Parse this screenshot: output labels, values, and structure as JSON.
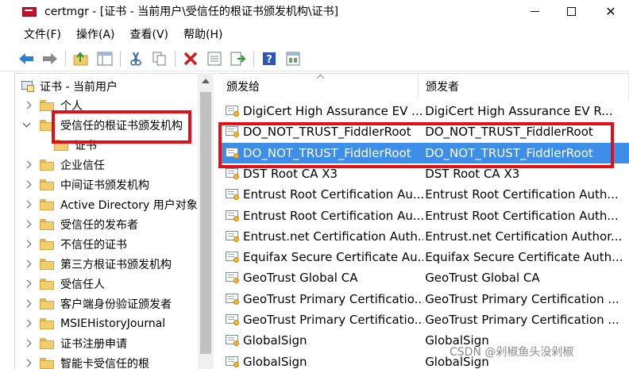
{
  "window": {
    "title": "certmgr - [证书 - 当前用户\\受信任的根证书颁发机构\\证书]",
    "controls": {
      "minimize": "",
      "maximize": "",
      "close": "✕"
    }
  },
  "menu": [
    "文件(F)",
    "操作(A)",
    "查看(V)",
    "帮助(H)"
  ],
  "toolbar": {
    "icons": [
      "back-arrow-icon",
      "forward-arrow-icon",
      "up-folder-icon",
      "show-hide-tree-icon",
      "cut-icon",
      "copy-icon",
      "delete-icon",
      "properties-icon",
      "export-icon",
      "help-icon",
      "view-icon"
    ],
    "colors": {
      "back": "#2e7fd3",
      "forward": "#8a8a8a",
      "delete": "#d01c1c",
      "help": "#2a56b8"
    }
  },
  "tree": {
    "root": "证书 - 当前用户",
    "items": [
      {
        "label": "个人",
        "expanded": false
      },
      {
        "label": "受信任的根证书颁发机构",
        "expanded": true
      },
      {
        "label": "证书",
        "child": true
      },
      {
        "label": "企业信任",
        "expanded": false
      },
      {
        "label": "中间证书颁发机构",
        "expanded": false
      },
      {
        "label": "Active Directory 用户对象",
        "expanded": false
      },
      {
        "label": "受信任的发布者",
        "expanded": false
      },
      {
        "label": "不信任的证书",
        "expanded": false
      },
      {
        "label": "第三方根证书颁发机构",
        "expanded": false
      },
      {
        "label": "受信任人",
        "expanded": false
      },
      {
        "label": "客户端身份验证颁发者",
        "expanded": false
      },
      {
        "label": "MSIEHistoryJournal",
        "expanded": false
      },
      {
        "label": "证书注册申请",
        "expanded": false
      },
      {
        "label": "智能卡受信任的根",
        "expanded": false
      }
    ]
  },
  "list": {
    "columns": [
      "颁发给",
      "颁发者"
    ],
    "selected_index": 2,
    "rows": [
      {
        "issued_to": "DigiCert High Assurance EV ...",
        "issued_by": "DigiCert High Assurance EV R..."
      },
      {
        "issued_to": "DO_NOT_TRUST_FiddlerRoot",
        "issued_by": "DO_NOT_TRUST_FiddlerRoot"
      },
      {
        "issued_to": "DO_NOT_TRUST_FiddlerRoot",
        "issued_by": "DO_NOT_TRUST_FiddlerRoot"
      },
      {
        "issued_to": "DST Root CA X3",
        "issued_by": "DST Root CA X3"
      },
      {
        "issued_to": "Entrust Root Certification Au...",
        "issued_by": "Entrust Root Certification Auth..."
      },
      {
        "issued_to": "Entrust Root Certification Au...",
        "issued_by": "Entrust Root Certification Auth..."
      },
      {
        "issued_to": "Entrust.net Certification Auth...",
        "issued_by": "Entrust.net Certification Author..."
      },
      {
        "issued_to": "Equifax Secure Certificate Au...",
        "issued_by": "Equifax Secure Certificate Auth..."
      },
      {
        "issued_to": "GeoTrust Global CA",
        "issued_by": "GeoTrust Global CA"
      },
      {
        "issued_to": "GeoTrust Primary Certificatio...",
        "issued_by": "GeoTrust Primary Certification ..."
      },
      {
        "issued_to": "GeoTrust Primary Certificatio...",
        "issued_by": "GeoTrust Primary Certification ..."
      },
      {
        "issued_to": "GlobalSign",
        "issued_by": "GlobalSign"
      },
      {
        "issued_to": "GlobalSign",
        "issued_by": "GlobalSign"
      }
    ]
  },
  "watermark": "CSDN @剁椒鱼头没剁椒",
  "highlight_color": "#e0101a",
  "selection_color": "#3d8ee8"
}
